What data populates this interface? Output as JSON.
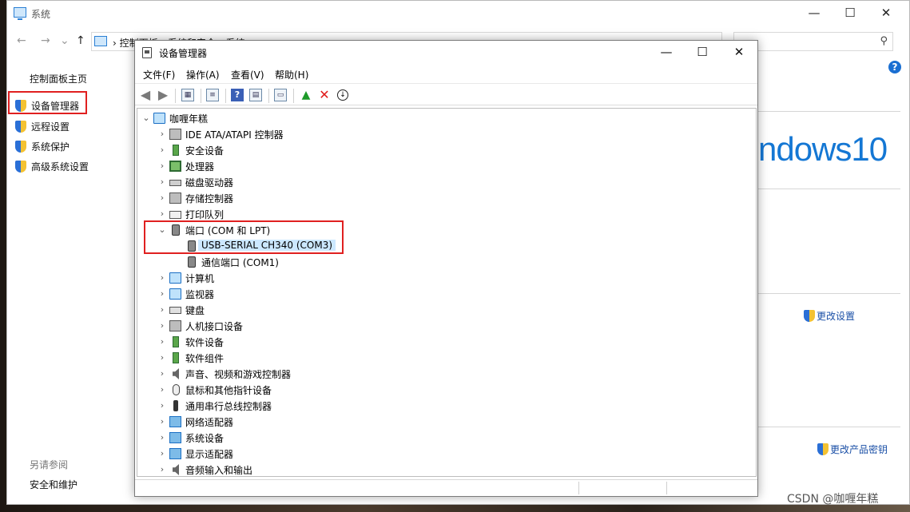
{
  "system_window": {
    "title": "系统",
    "breadcrumb": "›  控制面板  ›  系统和安全  ›  系统",
    "left_pane": {
      "home": "控制面板主页",
      "links": [
        "设备管理器",
        "远程设置",
        "系统保护",
        "高级系统设置"
      ],
      "see_also": "另请参阅",
      "security": "安全和维护"
    },
    "windows_logo_text": "ndows10",
    "change_settings": "更改设置",
    "change_product_key": "更改产品密钥",
    "help": "?"
  },
  "device_manager": {
    "title": "设备管理器",
    "menu": [
      "文件(F)",
      "操作(A)",
      "查看(V)",
      "帮助(H)"
    ],
    "tree": {
      "root": "咖喱年糕",
      "items": [
        {
          "label": "IDE ATA/ATAPI 控制器",
          "icon": "ide-controller-icon",
          "expanded": false
        },
        {
          "label": "安全设备",
          "icon": "security-device-icon",
          "expanded": false
        },
        {
          "label": "处理器",
          "icon": "processor-icon",
          "expanded": false
        },
        {
          "label": "磁盘驱动器",
          "icon": "disk-drive-icon",
          "expanded": false
        },
        {
          "label": "存储控制器",
          "icon": "storage-controller-icon",
          "expanded": false
        },
        {
          "label": "打印队列",
          "icon": "printer-icon",
          "expanded": false
        },
        {
          "label": "端口 (COM 和 LPT)",
          "icon": "port-icon",
          "expanded": true,
          "children": [
            {
              "label": "USB-SERIAL CH340 (COM3)",
              "selected": true
            },
            {
              "label": "通信端口 (COM1)",
              "selected": false
            }
          ]
        },
        {
          "label": "计算机",
          "icon": "computer-icon",
          "expanded": false
        },
        {
          "label": "监视器",
          "icon": "monitor-icon",
          "expanded": false
        },
        {
          "label": "键盘",
          "icon": "keyboard-icon",
          "expanded": false
        },
        {
          "label": "人机接口设备",
          "icon": "hid-icon",
          "expanded": false
        },
        {
          "label": "软件设备",
          "icon": "software-device-icon",
          "expanded": false
        },
        {
          "label": "软件组件",
          "icon": "software-component-icon",
          "expanded": false
        },
        {
          "label": "声音、视频和游戏控制器",
          "icon": "sound-icon",
          "expanded": false
        },
        {
          "label": "鼠标和其他指针设备",
          "icon": "mouse-icon",
          "expanded": false
        },
        {
          "label": "通用串行总线控制器",
          "icon": "usb-icon",
          "expanded": false
        },
        {
          "label": "网络适配器",
          "icon": "network-icon",
          "expanded": false
        },
        {
          "label": "系统设备",
          "icon": "system-device-icon",
          "expanded": false
        },
        {
          "label": "显示适配器",
          "icon": "display-adapter-icon",
          "expanded": false
        },
        {
          "label": "音频输入和输出",
          "icon": "audio-io-icon",
          "expanded": false
        }
      ]
    }
  },
  "watermark": "CSDN @咖喱年糕",
  "colors": {
    "highlight_red": "#e02020",
    "selection": "#cce8ff",
    "link_blue": "#1a4fa6",
    "win_blue": "#1477d4"
  }
}
